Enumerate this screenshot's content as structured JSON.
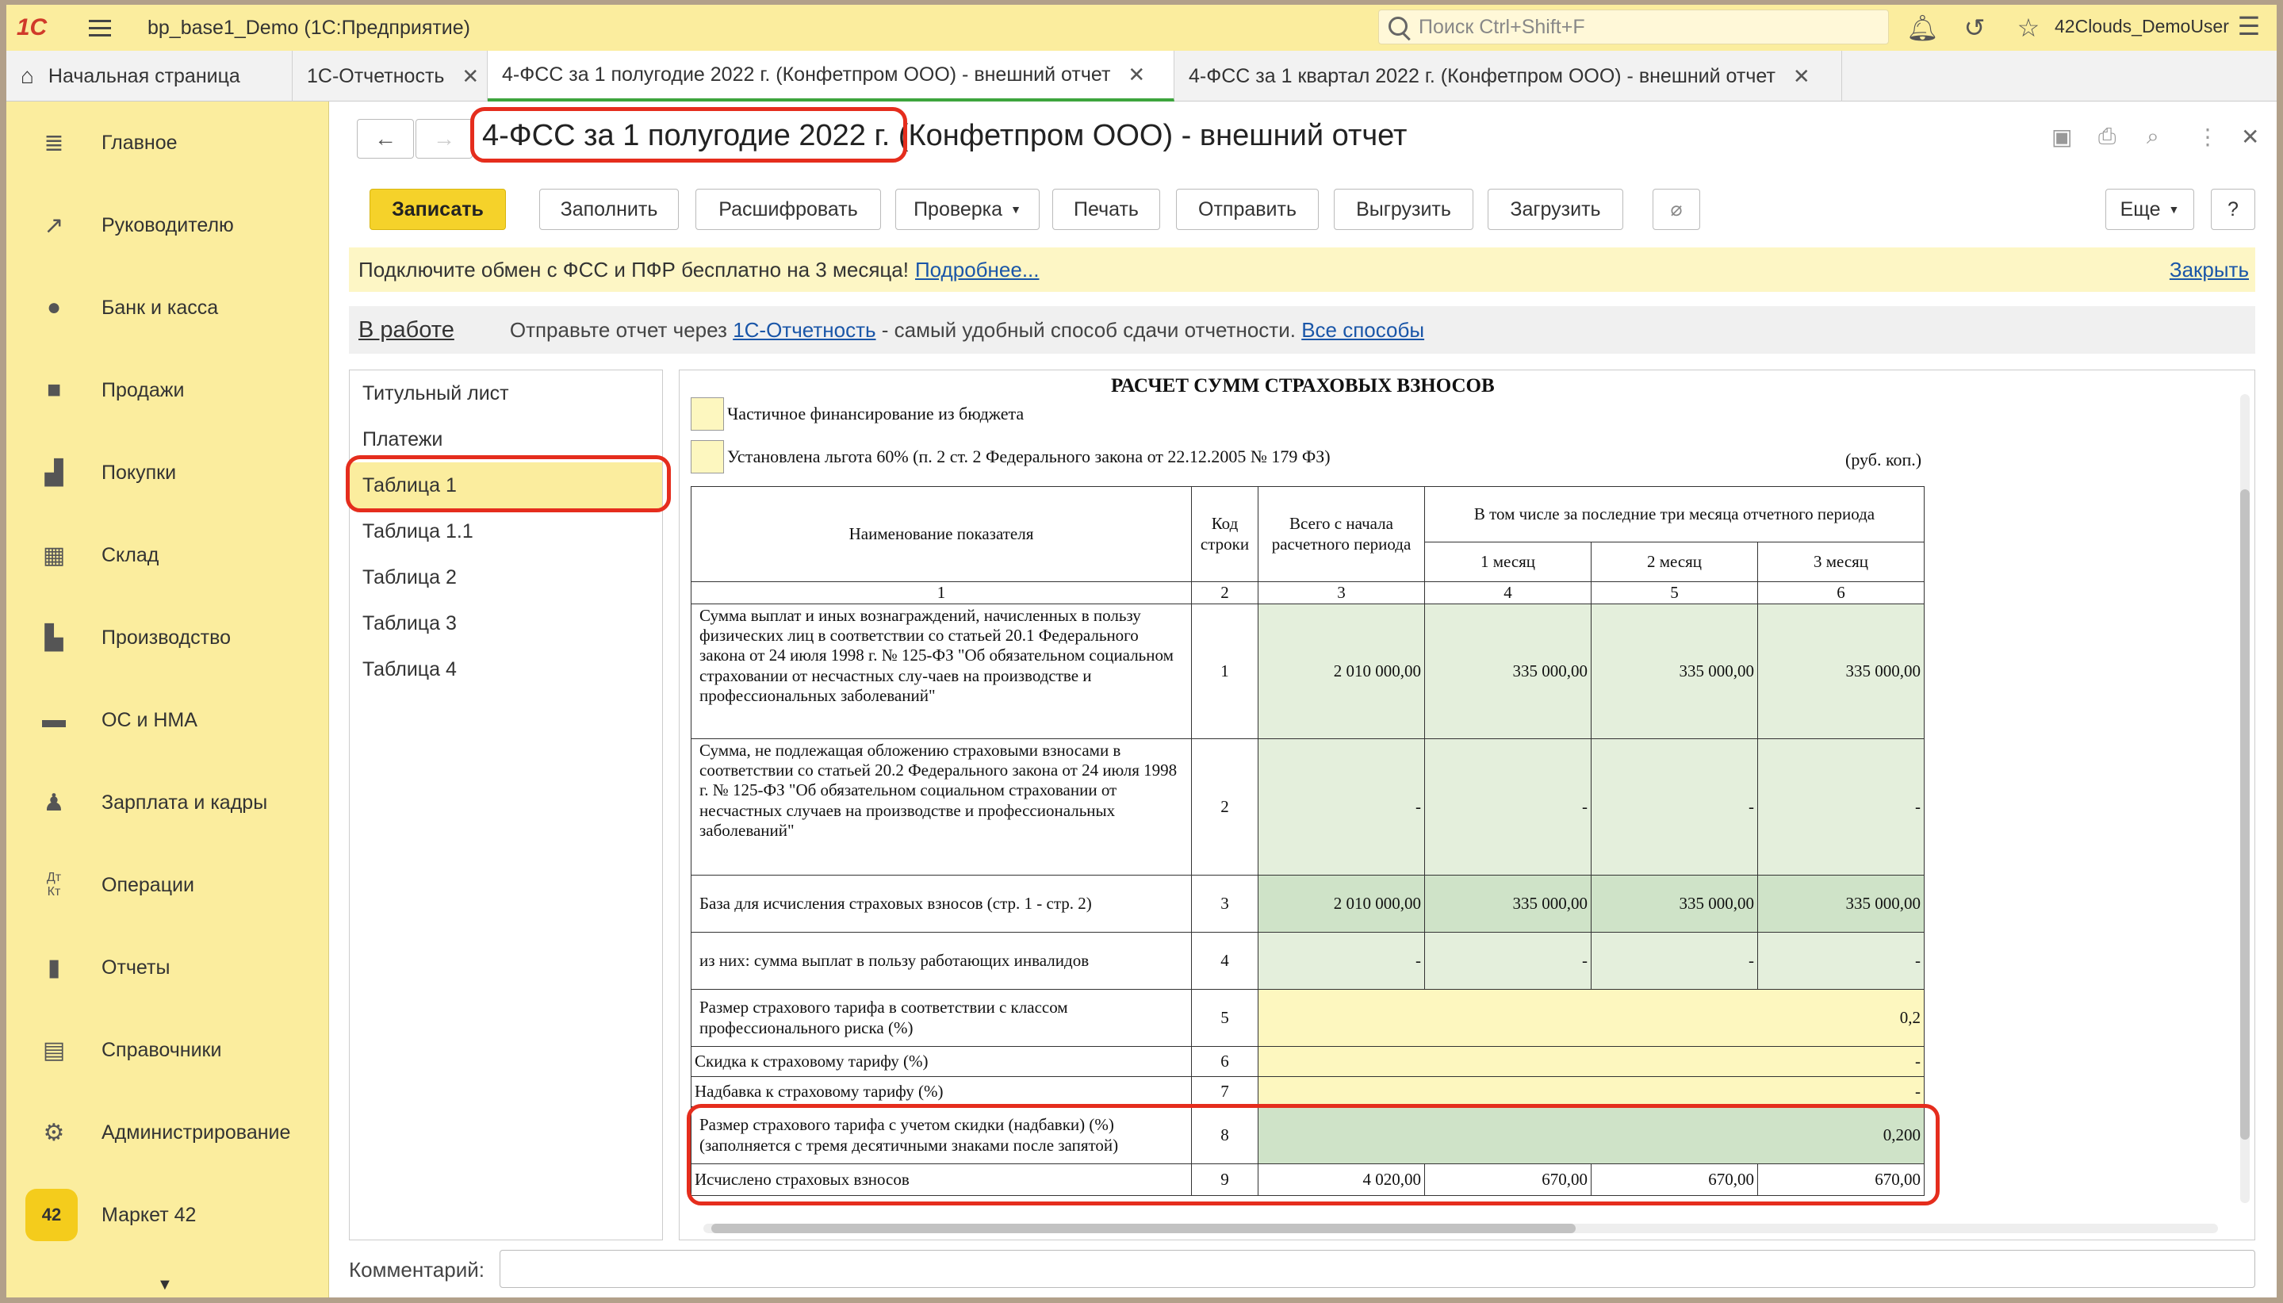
{
  "app": {
    "title": "bp_base1_Demo  (1С:Предприятие)",
    "logo": "1С",
    "search_placeholder": "Поиск Ctrl+Shift+F",
    "user": "42Clouds_DemoUser"
  },
  "tabs": [
    {
      "label": "Начальная страница"
    },
    {
      "label": "1С-Отчетность"
    },
    {
      "label": "4-ФСС за 1 полугодие 2022 г. (Конфетпром ООО) - внешний отчет"
    },
    {
      "label": "4-ФСС за 1 квартал 2022 г. (Конфетпром ООО) - внешний отчет"
    }
  ],
  "sidebar": {
    "items": [
      {
        "label": "Главное",
        "icon": "menu-icon"
      },
      {
        "label": "Руководителю",
        "icon": "trend-icon"
      },
      {
        "label": "Банк и касса",
        "icon": "coin-icon"
      },
      {
        "label": "Продажи",
        "icon": "bag-icon"
      },
      {
        "label": "Покупки",
        "icon": "cart-icon"
      },
      {
        "label": "Склад",
        "icon": "warehouse-icon"
      },
      {
        "label": "Производство",
        "icon": "factory-icon"
      },
      {
        "label": "ОС и НМА",
        "icon": "truck-icon"
      },
      {
        "label": "Зарплата и кадры",
        "icon": "person-icon"
      },
      {
        "label": "Операции",
        "icon": "dt-kt-icon"
      },
      {
        "label": "Отчеты",
        "icon": "bar-chart-icon"
      },
      {
        "label": "Справочники",
        "icon": "book-icon"
      },
      {
        "label": "Администрирование",
        "icon": "gear-icon"
      },
      {
        "label": "Маркет 42",
        "icon": "market-icon",
        "badge": "42"
      }
    ]
  },
  "doc": {
    "title": "4-ФСС за 1 полугодие 2022 г. (Конфетпром ООО) - внешний отчет",
    "toolbar": {
      "save": "Записать",
      "fill": "Заполнить",
      "decode": "Расшифровать",
      "check": "Проверка",
      "print": "Печать",
      "send": "Отправить",
      "export": "Выгрузить",
      "import": "Загрузить",
      "more": "Еще",
      "help": "?"
    },
    "promo": {
      "text": "Подключите обмен с ФСС и ПФР бесплатно на 3 месяца!",
      "link": "Подробнее...",
      "close": "Закрыть"
    },
    "status": {
      "state": "В работе",
      "text1": "Отправьте отчет через",
      "link1": "1С-Отчетность",
      "text2": "- самый удобный способ сдачи отчетности.",
      "link2": "Все способы"
    },
    "sheets": [
      "Титульный лист",
      "Платежи",
      "Таблица 1",
      "Таблица 1.1",
      "Таблица 2",
      "Таблица 3",
      "Таблица 4"
    ],
    "comment_label": "Комментарий:"
  },
  "report": {
    "title": "РАСЧЕТ СУММ СТРАХОВЫХ ВЗНОСОВ",
    "cb1": "Частичное финансирование из бюджета",
    "cb2": "Установлена льгота 60% (п. 2 ст. 2 Федерального закона от 22.12.2005 № 179 ФЗ)",
    "unit": "(руб. коп.)",
    "headers": {
      "name": "Наименование показателя",
      "code": "Код строки",
      "total": "Всего с начала расчетного периода",
      "last3": "В том числе за последние три месяца отчетного периода",
      "m1": "1 месяц",
      "m2": "2 месяц",
      "m3": "3 месяц",
      "n1": "1",
      "n2": "2",
      "n3": "3",
      "n4": "4",
      "n5": "5",
      "n6": "6"
    },
    "rows": [
      {
        "name": "Сумма выплат и иных вознаграждений, начисленных в пользу физических лиц в соответствии со статьей 20.1 Федерального закона от 24 июля 1998 г. № 125-ФЗ \"Об обязательном социальном страховании от несчастных слу-чаев на производстве и профессиональных заболеваний\"",
        "code": "1",
        "v": [
          "2 010 000,00",
          "335 000,00",
          "335 000,00",
          "335 000,00"
        ]
      },
      {
        "name": "Сумма, не подлежащая обложению страховыми взносами в соответствии со статьей 20.2 Федерального закона от 24 июля 1998 г. № 125-ФЗ \"Об обязательном социальном страховании от несчастных случаев на производстве и профессиональных заболеваний\"",
        "code": "2",
        "v": [
          "-",
          "-",
          "-",
          "-"
        ]
      },
      {
        "name": "База для исчисления страховых взносов (стр. 1 - стр. 2)",
        "code": "3",
        "v": [
          "2 010 000,00",
          "335 000,00",
          "335 000,00",
          "335 000,00"
        ]
      },
      {
        "name": "из них: сумма выплат в пользу работающих инвалидов",
        "code": "4",
        "v": [
          "-",
          "-",
          "-",
          "-"
        ]
      },
      {
        "name": "Размер страхового тарифа в соответствии с классом профессионального риска (%)",
        "code": "5",
        "v": [
          "0,2"
        ]
      },
      {
        "name": "Скидка к страховому тарифу (%)",
        "code": "6",
        "v": [
          "-"
        ]
      },
      {
        "name": "Надбавка к страховому тарифу (%)",
        "code": "7",
        "v": [
          "-"
        ]
      },
      {
        "name": "Размер страхового тарифа с учетом скидки (надбавки) (%) (заполняется с тремя десятичными знаками после запятой)",
        "code": "8",
        "v": [
          "0,200"
        ]
      },
      {
        "name": "Исчислено страховых взносов",
        "code": "9",
        "v": [
          "4 020,00",
          "670,00",
          "670,00",
          "670,00"
        ]
      }
    ]
  },
  "colors": {
    "accent_yellow": "#fbed9e",
    "save_button": "#f5d22a",
    "active_tab": "#3da53d",
    "highlight": "#e52d1d",
    "link": "#1a56a8",
    "cell_green": "#e4efdc"
  }
}
